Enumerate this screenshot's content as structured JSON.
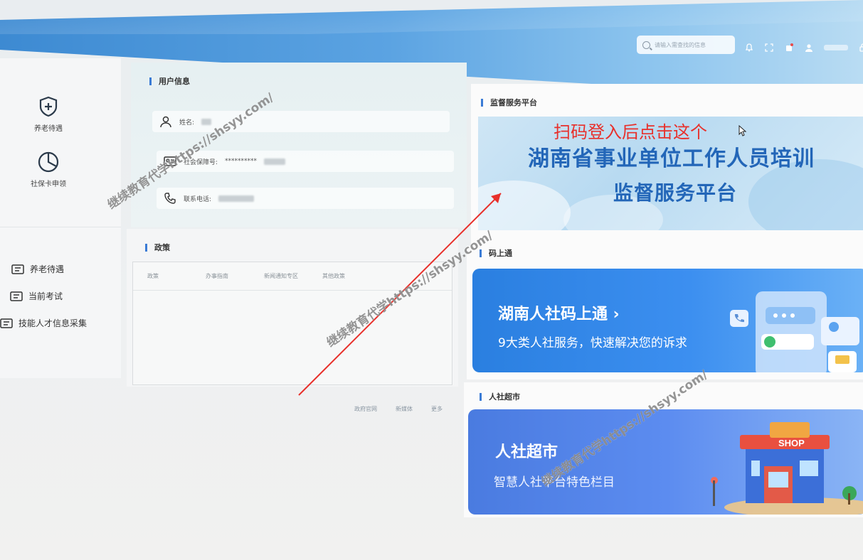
{
  "header": {
    "search_placeholder": "请输入需查找的信息",
    "icons": [
      "bell-icon",
      "fullscreen-icon",
      "skin-icon",
      "user-icon",
      "lock-icon"
    ]
  },
  "sidebar": {
    "tiles": [
      {
        "label": "养老待遇",
        "icon": "shield-plus-icon"
      },
      {
        "label": "社保卡申领",
        "icon": "pie-chart-icon"
      }
    ],
    "items": [
      {
        "label": "养老待遇",
        "icon": "ticket-icon"
      },
      {
        "label": "当前考试",
        "icon": "ticket-icon"
      },
      {
        "label": "技能人才信息采集",
        "icon": "ticket-icon"
      }
    ]
  },
  "user_info": {
    "title": "用户信息",
    "name_label": "姓名:",
    "social_label": "社会保障号:",
    "social_value": "**********",
    "phone_label": "联系电话:"
  },
  "policy": {
    "title": "政策",
    "columns": [
      "政策",
      "办事指南",
      "新闻通知专区",
      "其他政策"
    ],
    "footer_links": [
      "政府官网",
      "新媒体",
      "更多"
    ]
  },
  "supervise": {
    "title": "监督服务平台",
    "banner_line1": "湖南省事业单位工作人员培训",
    "banner_line2": "监督服务平台"
  },
  "mashang": {
    "title": "码上通",
    "banner_title": "湖南人社码上通 ›",
    "banner_sub": "9大类人社服务，快速解决您的诉求"
  },
  "renshe": {
    "title": "人社超市",
    "banner_title": "人社超市",
    "banner_sub": "智慧人社平台特色栏目",
    "shop_sign": "SHOP"
  },
  "annotation": {
    "text": "扫码登入后点击这个",
    "color": "#e8302b"
  },
  "watermark": {
    "text": "继续教育代学https://shsyy.com/"
  },
  "colors": {
    "accent": "#3a7bd5",
    "header": "#4f9ae0",
    "banner_text": "#2366b8"
  }
}
